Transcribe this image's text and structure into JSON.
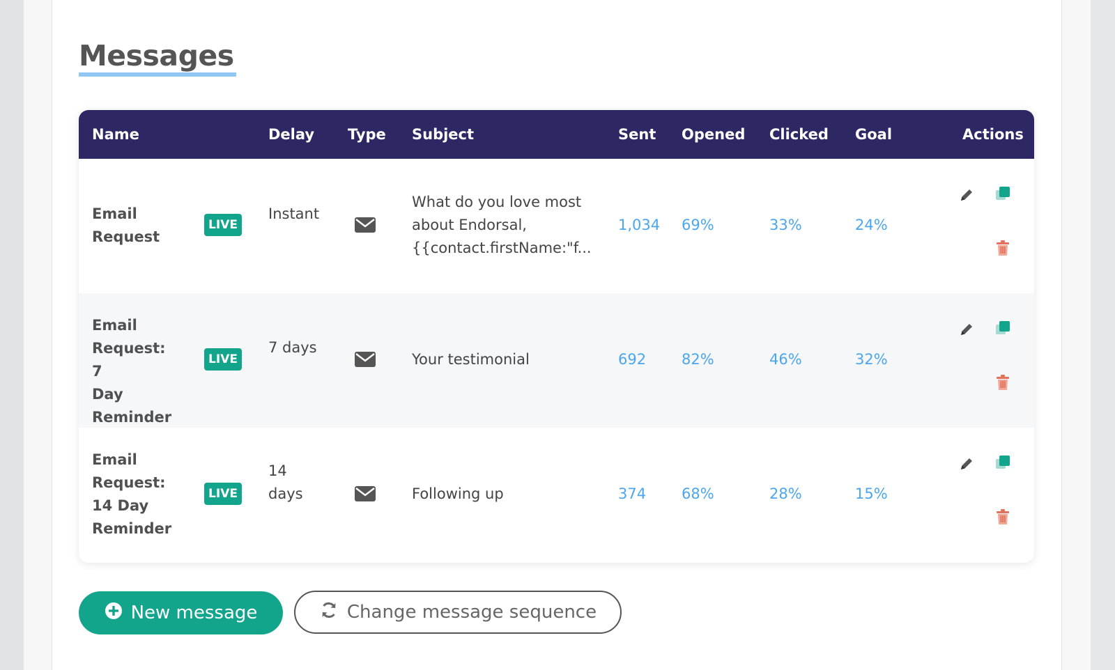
{
  "page": {
    "title": "Messages"
  },
  "table": {
    "headers": {
      "name": "Name",
      "delay": "Delay",
      "type": "Type",
      "subject": "Subject",
      "sent": "Sent",
      "opened": "Opened",
      "clicked": "Clicked",
      "goal": "Goal",
      "actions": "Actions"
    },
    "rows": [
      {
        "name_lines": [
          "Email",
          "Request"
        ],
        "status": "LIVE",
        "delay_lines": [
          "Instant"
        ],
        "type_icon": "envelope-icon",
        "subject_lines": [
          "What do you love most",
          "about Endorsal,",
          "{{contact.firstName:\"f..."
        ],
        "sent": "1,034",
        "opened": "69%",
        "clicked": "33%",
        "goal": "24%"
      },
      {
        "name_lines": [
          "Email",
          "Request: 7",
          "Day",
          "Reminder"
        ],
        "status": "LIVE",
        "delay_lines": [
          "7 days"
        ],
        "type_icon": "envelope-icon",
        "subject_lines": [
          "Your testimonial"
        ],
        "sent": "692",
        "opened": "82%",
        "clicked": "46%",
        "goal": "32%"
      },
      {
        "name_lines": [
          "Email",
          "Request:",
          "14 Day",
          "Reminder"
        ],
        "status": "LIVE",
        "delay_lines": [
          "14",
          "days"
        ],
        "type_icon": "envelope-icon",
        "subject_lines": [
          "Following up"
        ],
        "sent": "374",
        "opened": "68%",
        "clicked": "28%",
        "goal": "15%"
      }
    ]
  },
  "buttons": {
    "new_message": "New message",
    "change_sequence": "Change message sequence"
  },
  "colors": {
    "header_bg": "#2d2863",
    "accent_green": "#12a58c",
    "stat_blue": "#4ba6ee",
    "delete_red": "#e2725b"
  }
}
